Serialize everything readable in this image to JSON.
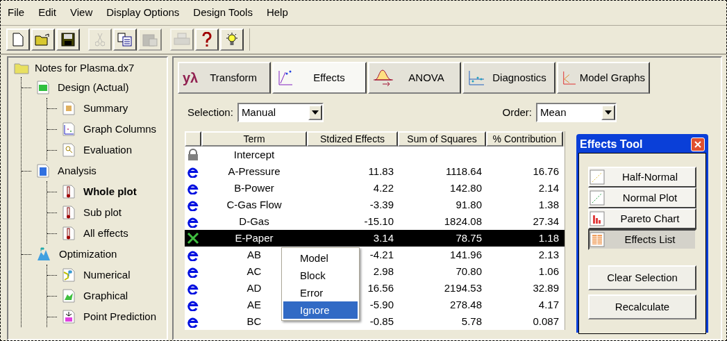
{
  "menu": [
    "File",
    "Edit",
    "View",
    "Display Options",
    "Design Tools",
    "Help"
  ],
  "toolbar": [
    {
      "kind": "new",
      "disabled": false
    },
    {
      "kind": "open",
      "disabled": false
    },
    {
      "kind": "save",
      "disabled": false
    },
    {
      "kind": "cut",
      "disabled": true
    },
    {
      "kind": "copy",
      "disabled": false
    },
    {
      "kind": "paste",
      "disabled": true
    },
    {
      "kind": "print",
      "disabled": true
    },
    {
      "kind": "help",
      "disabled": false
    },
    {
      "kind": "tip",
      "disabled": false
    }
  ],
  "tree": {
    "label": "Notes for Plasma.dx7",
    "children": [
      {
        "label": "Design (Actual)",
        "selected": false,
        "children": [
          {
            "label": "Summary",
            "selected": false
          },
          {
            "label": "Graph Columns",
            "selected": false
          },
          {
            "label": "Evaluation",
            "selected": false
          }
        ]
      },
      {
        "label": "Analysis",
        "selected": false,
        "children": [
          {
            "label": "Whole plot",
            "selected": true
          },
          {
            "label": "Sub plot",
            "selected": false
          },
          {
            "label": "All effects",
            "selected": false
          }
        ]
      },
      {
        "label": "Optimization",
        "selected": false,
        "children": [
          {
            "label": "Numerical",
            "selected": false
          },
          {
            "label": "Graphical",
            "selected": false
          },
          {
            "label": "Point Prediction",
            "selected": false
          }
        ]
      }
    ]
  },
  "tabs": [
    {
      "label": "Transform",
      "symbol": "yλ",
      "selected": false
    },
    {
      "label": "Effects",
      "selected": true
    },
    {
      "label": "ANOVA",
      "selected": false
    },
    {
      "label": "Diagnostics",
      "selected": false
    },
    {
      "label": "Model Graphs",
      "selected": false
    }
  ],
  "selection": {
    "label": "Selection:",
    "value": "Manual"
  },
  "order": {
    "label": "Order:",
    "value": "Mean"
  },
  "table": {
    "columns": [
      "Term",
      "Stdized Effects",
      "Sum of Squares",
      "% Contribution"
    ],
    "rows": [
      {
        "kind": "locked",
        "term": "Intercept",
        "selected": false
      },
      {
        "kind": "effect",
        "term": "A-Pressure",
        "effect": "11.83",
        "ss": "1118.64",
        "pct": "16.76",
        "selected": false
      },
      {
        "kind": "effect",
        "term": "B-Power",
        "effect": "4.22",
        "ss": "142.80",
        "pct": "2.14",
        "selected": false
      },
      {
        "kind": "effect",
        "term": "C-Gas Flow",
        "effect": "-3.39",
        "ss": "91.80",
        "pct": "1.38",
        "selected": false
      },
      {
        "kind": "effect",
        "term": "D-Gas",
        "effect": "-15.10",
        "ss": "1824.08",
        "pct": "27.34",
        "selected": false
      },
      {
        "kind": "ignored",
        "term": "E-Paper",
        "effect": "3.14",
        "ss": "78.75",
        "pct": "1.18",
        "selected": true
      },
      {
        "kind": "effect",
        "term": "AB",
        "effect": "-4.21",
        "ss": "141.96",
        "pct": "2.13",
        "selected": false
      },
      {
        "kind": "effect",
        "term": "AC",
        "effect": "2.98",
        "ss": "70.80",
        "pct": "1.06",
        "selected": false
      },
      {
        "kind": "effect",
        "term": "AD",
        "effect": "16.56",
        "ss": "2194.53",
        "pct": "32.89",
        "selected": false
      },
      {
        "kind": "effect",
        "term": "AE",
        "effect": "-5.90",
        "ss": "278.48",
        "pct": "4.17",
        "selected": false
      },
      {
        "kind": "effect",
        "term": "BC",
        "effect": "-0.85",
        "ss": "5.78",
        "pct": "0.087",
        "selected": false
      }
    ]
  },
  "context_menu": [
    {
      "label": "Model",
      "selected": false
    },
    {
      "label": "Block",
      "selected": false
    },
    {
      "label": "Error",
      "selected": false
    },
    {
      "label": "Ignore",
      "selected": true
    }
  ],
  "effects_tool": {
    "title": "Effects Tool",
    "views": [
      {
        "label": "Half-Normal",
        "selected": false
      },
      {
        "label": "Normal Plot",
        "selected": false
      },
      {
        "label": "Pareto Chart",
        "selected": false
      },
      {
        "label": "Effects List",
        "selected": true
      }
    ],
    "actions": [
      "Clear Selection",
      "Recalculate"
    ]
  }
}
